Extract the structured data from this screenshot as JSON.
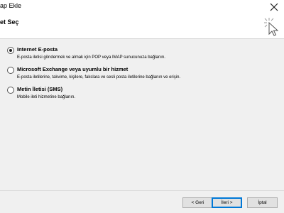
{
  "window": {
    "title": "ap Ekle"
  },
  "header": {
    "title": "et Seç"
  },
  "options": [
    {
      "label": "Internet E-posta",
      "description": "E-posta iletisi göndermek ve almak için POP veya IMAP sunucunuza bağlanın.",
      "selected": true
    },
    {
      "label": "Microsoft Exchange veya uyumlu bir hizmet",
      "description": "E-posta iletilerine, takvime, kişilere, fakslara ve sesli posta iletilerine bağlanın ve erişin.",
      "selected": false
    },
    {
      "label": "Metin İletisi (SMS)",
      "description": "Mobile ileti hizmetine bağlanın.",
      "selected": false
    }
  ],
  "buttons": {
    "back": "< Geri",
    "next": "İleri >",
    "cancel": "İptal"
  }
}
